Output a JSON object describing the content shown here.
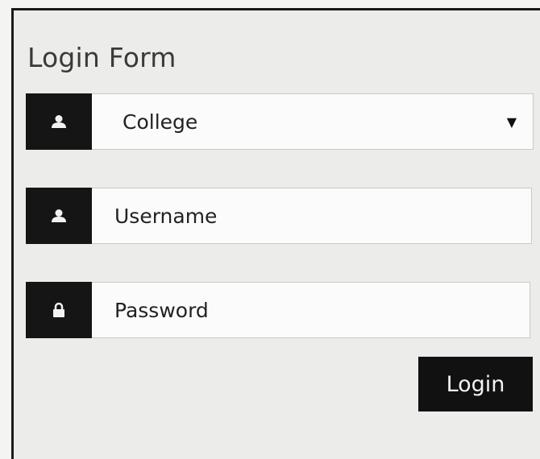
{
  "form": {
    "title": "Login Form",
    "college_select": {
      "value": "College",
      "icon": "user-icon"
    },
    "username": {
      "placeholder": "Username",
      "icon": "user-icon"
    },
    "password": {
      "placeholder": "Password",
      "icon": "lock-icon"
    },
    "login_label": "Login"
  }
}
